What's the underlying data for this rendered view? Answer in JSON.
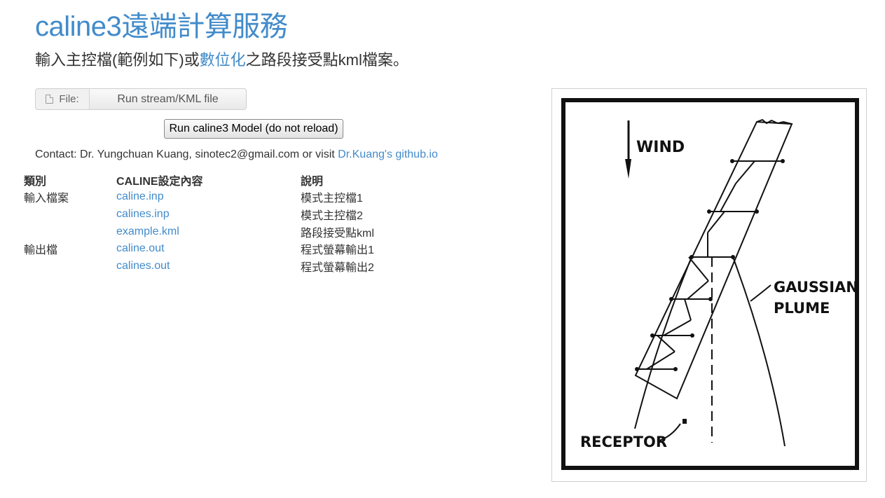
{
  "header": {
    "title": "caline3遠端計算服務",
    "subtitle_prefix": "輸入主控檔(範例如下)或",
    "subtitle_link": "數位化",
    "subtitle_suffix": "之路段接受點kml檔案。"
  },
  "upload": {
    "file_label": "File:",
    "file_button": "Run stream/KML file",
    "file_icon": "file-icon"
  },
  "run_button": "Run caline3 Model (do not reload)",
  "contact": {
    "text": "Contact: Dr. Yungchuan Kuang, sinotec2@gmail.com or visit ",
    "link": "Dr.Kuang's github.io"
  },
  "table": {
    "headers": [
      "類別",
      "CALINE設定內容",
      "說明"
    ],
    "rows": [
      {
        "category": "輸入檔案",
        "file": "caline.inp",
        "desc": "模式主控檔1"
      },
      {
        "category": "",
        "file": "calines.inp",
        "desc": "模式主控檔2"
      },
      {
        "category": "",
        "file": "example.kml",
        "desc": "路段接受點kml"
      },
      {
        "category": "輸出檔",
        "file": "caline.out",
        "desc": "程式螢幕輸出1"
      },
      {
        "category": "",
        "file": "calines.out",
        "desc": "程式螢幕輸出2"
      }
    ]
  },
  "figure": {
    "wind_label": "WIND",
    "plume_label_1": "GAUSSIAN",
    "plume_label_2": "PLUME",
    "receptor_label": "RECEPTOR"
  },
  "colors": {
    "link": "#428bca",
    "text": "#333333"
  }
}
